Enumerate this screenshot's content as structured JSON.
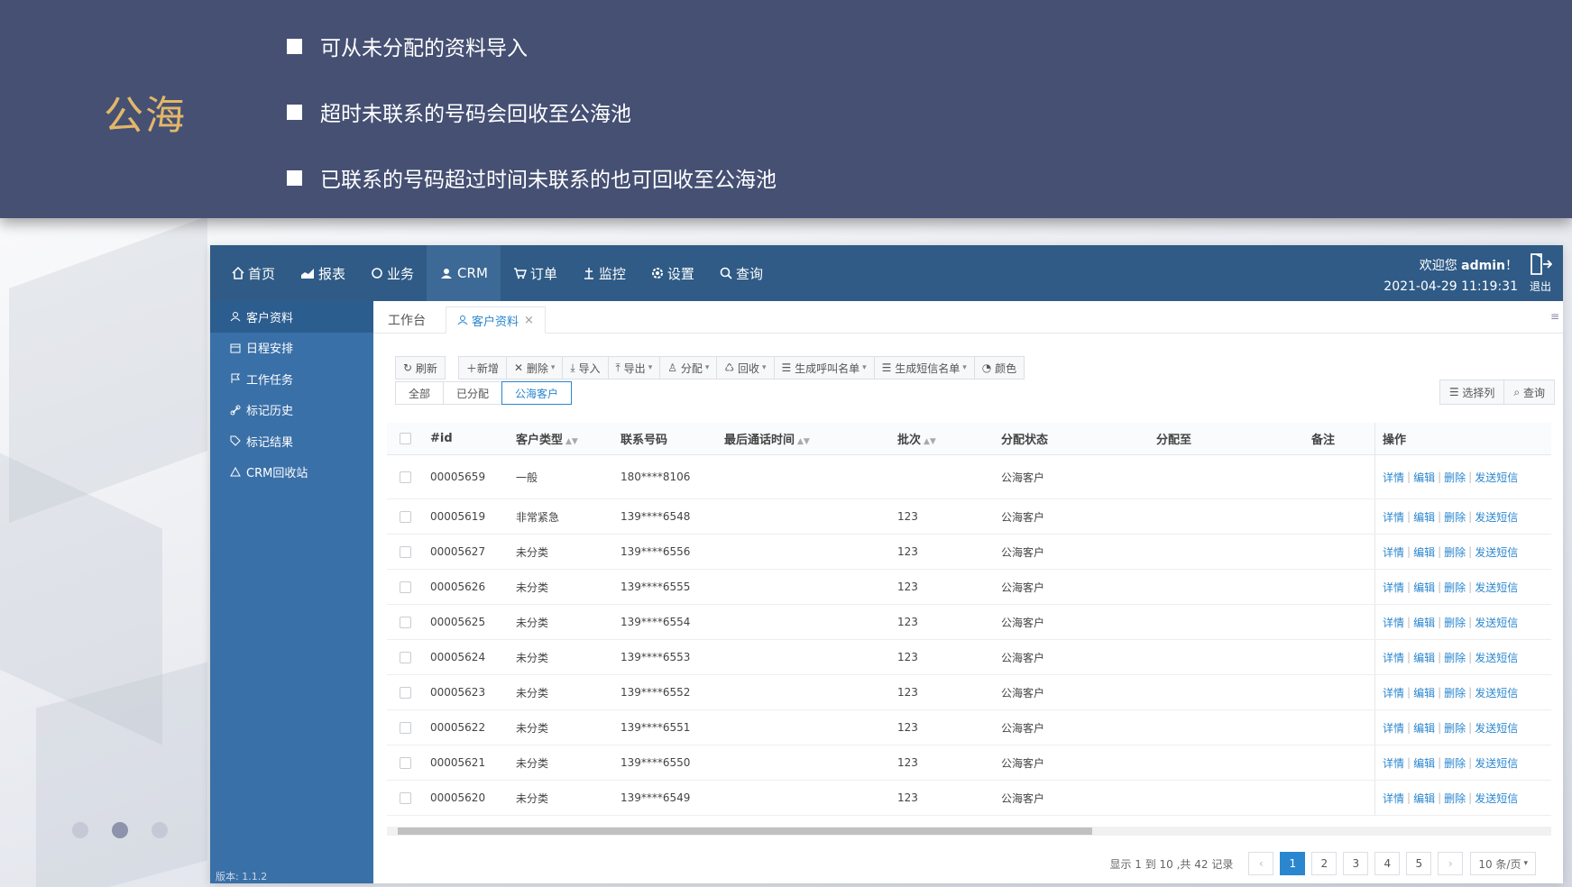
{
  "slide": {
    "title": "公海",
    "bullets": [
      "可从未分配的资料导入",
      "超时未联系的号码会回收至公海池",
      "已联系的号码超过时间未联系的也可回收至公海池"
    ]
  },
  "nav": {
    "items": [
      "首页",
      "报表",
      "业务",
      "CRM",
      "订单",
      "监控",
      "设置",
      "查询"
    ],
    "welcome_prefix": "欢迎您",
    "user": "admin",
    "welcome_suffix": "！",
    "datetime": "2021-04-29 11:19:31",
    "logout": "退出"
  },
  "sidebar": {
    "items": [
      "客户资料",
      "日程安排",
      "工作任务",
      "标记历史",
      "标记结果",
      "CRM回收站"
    ],
    "version": "版本: 1.1.2"
  },
  "tabs": {
    "workbench": "工作台",
    "customer": "客户资料",
    "close": "×"
  },
  "toolbar": {
    "refresh": "刷新",
    "add": "新增",
    "delete": "删除",
    "import": "导入",
    "export": "导出",
    "assign": "分配",
    "recycle": "回收",
    "call_list": "生成呼叫名单",
    "sms_list": "生成短信名单",
    "color": "颜色"
  },
  "filters": [
    "全部",
    "已分配",
    "公海客户"
  ],
  "right_tools": {
    "columns": "选择列",
    "search": "查询"
  },
  "table": {
    "headers": [
      "#id",
      "客户类型",
      "联系号码",
      "最后通话时间",
      "批次",
      "分配状态",
      "分配至",
      "备注",
      "操作"
    ],
    "ops": [
      "详情",
      "编辑",
      "删除",
      "发送短信"
    ],
    "rows": [
      {
        "id": "00005659",
        "type": "一般",
        "phone": "180****8106",
        "last": "",
        "batch": "",
        "status": "公海客户",
        "to": "",
        "note": ""
      },
      {
        "id": "00005619",
        "type": "非常紧急",
        "phone": "139****6548",
        "last": "",
        "batch": "123",
        "status": "公海客户",
        "to": "",
        "note": ""
      },
      {
        "id": "00005627",
        "type": "未分类",
        "phone": "139****6556",
        "last": "",
        "batch": "123",
        "status": "公海客户",
        "to": "",
        "note": ""
      },
      {
        "id": "00005626",
        "type": "未分类",
        "phone": "139****6555",
        "last": "",
        "batch": "123",
        "status": "公海客户",
        "to": "",
        "note": ""
      },
      {
        "id": "00005625",
        "type": "未分类",
        "phone": "139****6554",
        "last": "",
        "batch": "123",
        "status": "公海客户",
        "to": "",
        "note": ""
      },
      {
        "id": "00005624",
        "type": "未分类",
        "phone": "139****6553",
        "last": "",
        "batch": "123",
        "status": "公海客户",
        "to": "",
        "note": ""
      },
      {
        "id": "00005623",
        "type": "未分类",
        "phone": "139****6552",
        "last": "",
        "batch": "123",
        "status": "公海客户",
        "to": "",
        "note": ""
      },
      {
        "id": "00005622",
        "type": "未分类",
        "phone": "139****6551",
        "last": "",
        "batch": "123",
        "status": "公海客户",
        "to": "",
        "note": ""
      },
      {
        "id": "00005621",
        "type": "未分类",
        "phone": "139****6550",
        "last": "",
        "batch": "123",
        "status": "公海客户",
        "to": "",
        "note": ""
      },
      {
        "id": "00005620",
        "type": "未分类",
        "phone": "139****6549",
        "last": "",
        "batch": "123",
        "status": "公海客户",
        "to": "",
        "note": ""
      }
    ]
  },
  "pager": {
    "info": "显示 1 到 10 ,共 42 记录",
    "prev": "‹",
    "next": "›",
    "pages": [
      "1",
      "2",
      "3",
      "4",
      "5"
    ],
    "current": "1",
    "page_size": "10 条/页"
  }
}
